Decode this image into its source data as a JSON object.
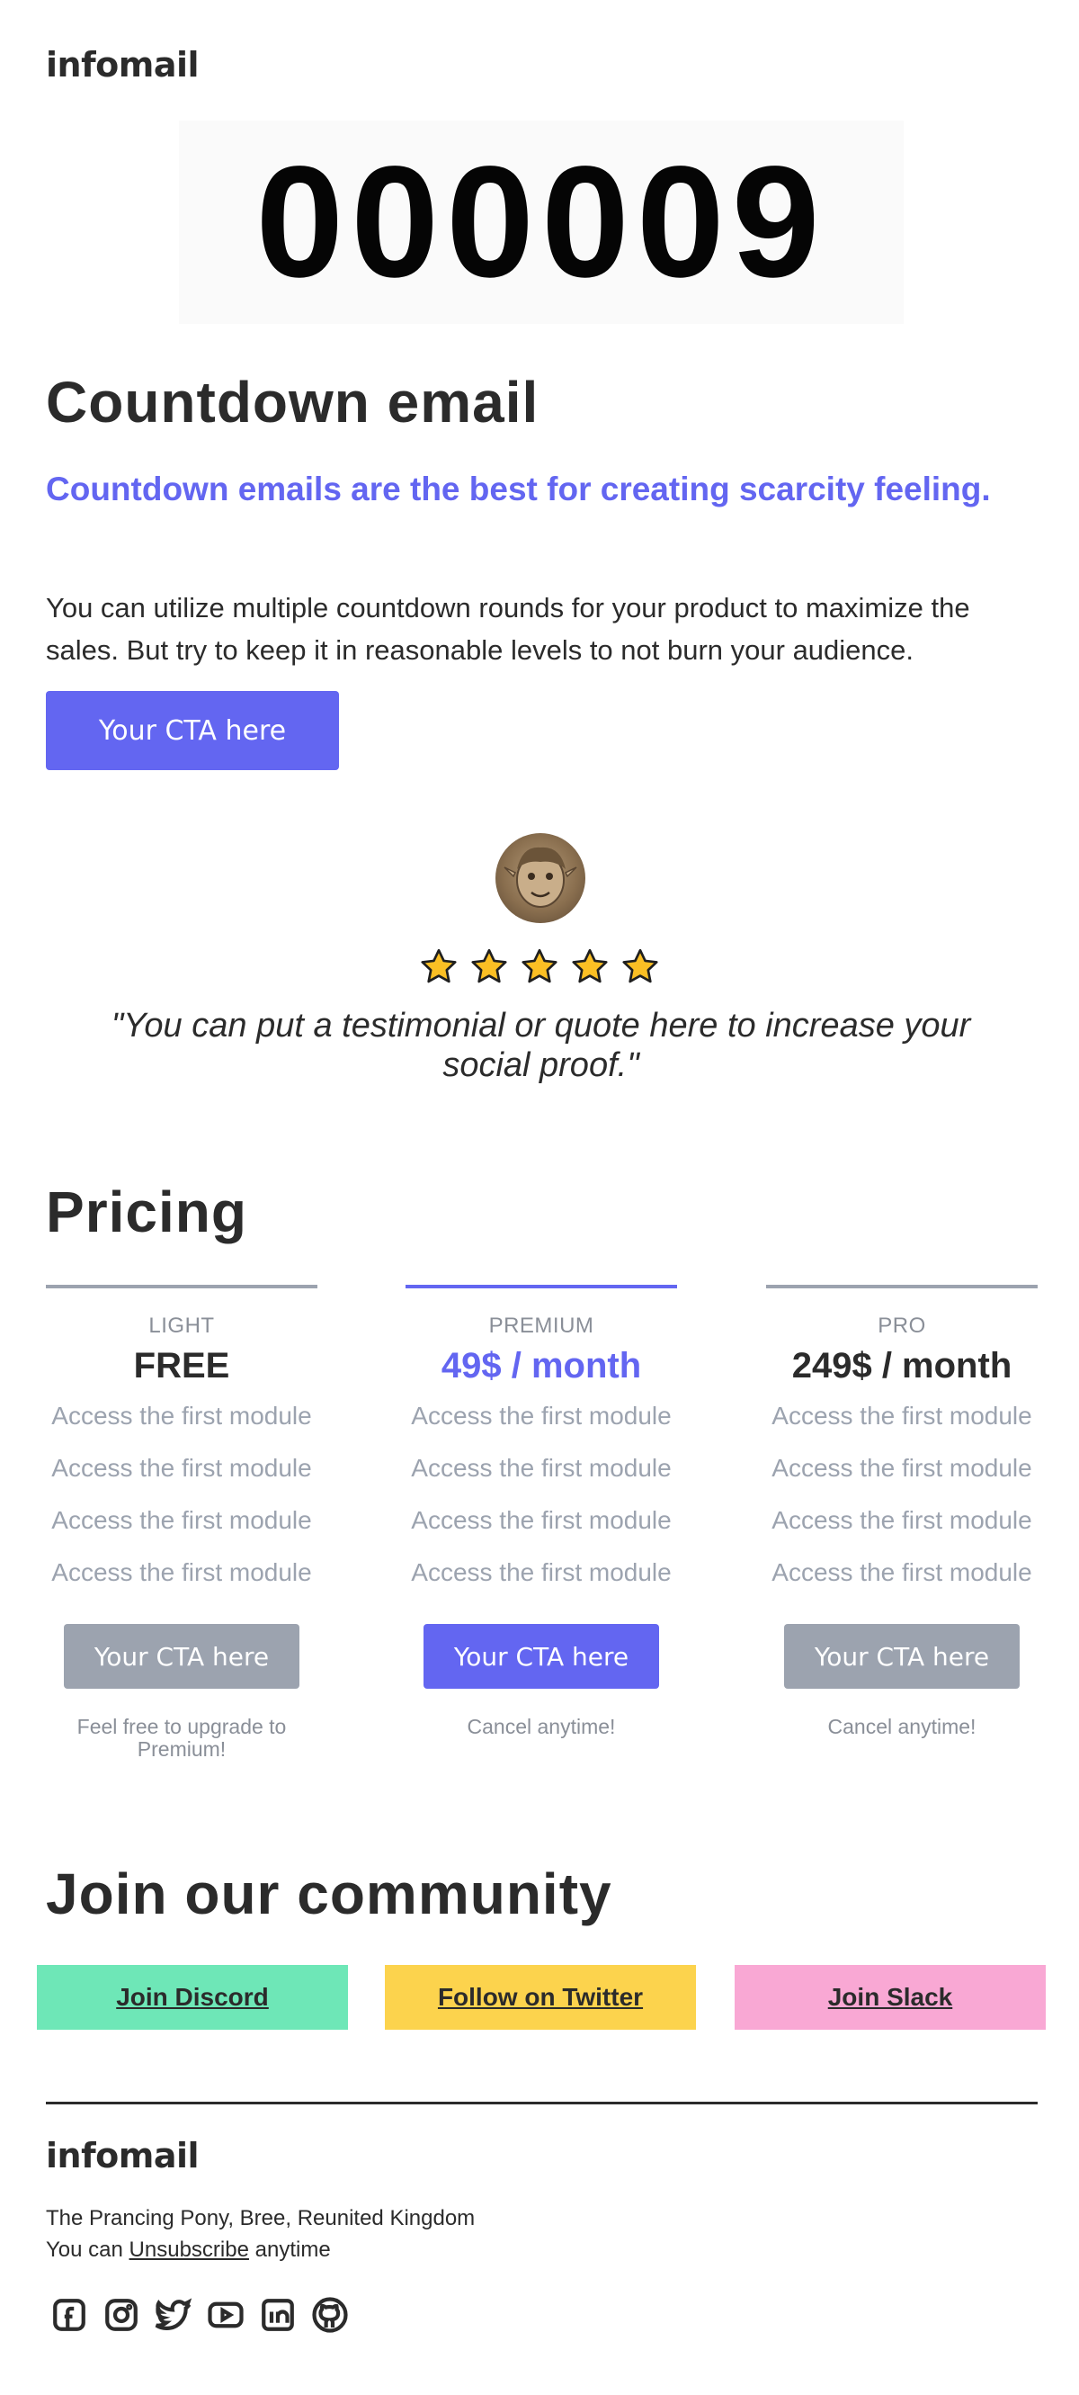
{
  "header": {
    "logo": "infomail"
  },
  "countdown": {
    "value": "000009"
  },
  "hero": {
    "title": "Countdown email",
    "subtitle": "Countdown emails are the best for creating scarcity feeling.",
    "body": "You can utilize multiple countdown rounds for your product to maximize the sales. But try to keep it in reasonable levels to not burn your audience.",
    "cta_label": "Your CTA here",
    "cta_color": "#6366f1"
  },
  "testimonial": {
    "rating": 5,
    "max_rating": 5,
    "quote": "\"You can put a testimonial or quote here to increase your social proof.\""
  },
  "pricing": {
    "title": "Pricing",
    "plans": [
      {
        "name": "LIGHT",
        "price": "FREE",
        "features": [
          "Access the first module",
          "Access the first module",
          "Access the first module",
          "Access the first module"
        ],
        "cta_label": "Your CTA here",
        "note": "Feel free to upgrade to Premium!"
      },
      {
        "name": "PREMIUM",
        "price": "49$ / month",
        "features": [
          "Access the first module",
          "Access the first module",
          "Access the first module",
          "Access the first module"
        ],
        "cta_label": "Your CTA here",
        "note": "Cancel anytime!"
      },
      {
        "name": "PRO",
        "price": "249$ / month",
        "features": [
          "Access the first module",
          "Access the first module",
          "Access the first module",
          "Access the first module"
        ],
        "cta_label": "Your CTA here",
        "note": "Cancel anytime!"
      }
    ]
  },
  "community": {
    "title": "Join our community",
    "links": [
      {
        "label": "Join Discord",
        "color": "#6ee7b7"
      },
      {
        "label": "Follow on Twitter",
        "color": "#fcd34d"
      },
      {
        "label": "Join Slack",
        "color": "#f9a8d4"
      }
    ]
  },
  "footer": {
    "logo": "infomail",
    "address": "The Prancing Pony, Bree, Reunited Kingdom",
    "unsubscribe_prefix": "You can",
    "unsubscribe_link": "Unsubscribe",
    "unsubscribe_suffix": "anytime",
    "social_icons": [
      "facebook-icon",
      "instagram-icon",
      "twitter-icon",
      "youtube-icon",
      "linkedin-icon",
      "github-icon"
    ]
  }
}
